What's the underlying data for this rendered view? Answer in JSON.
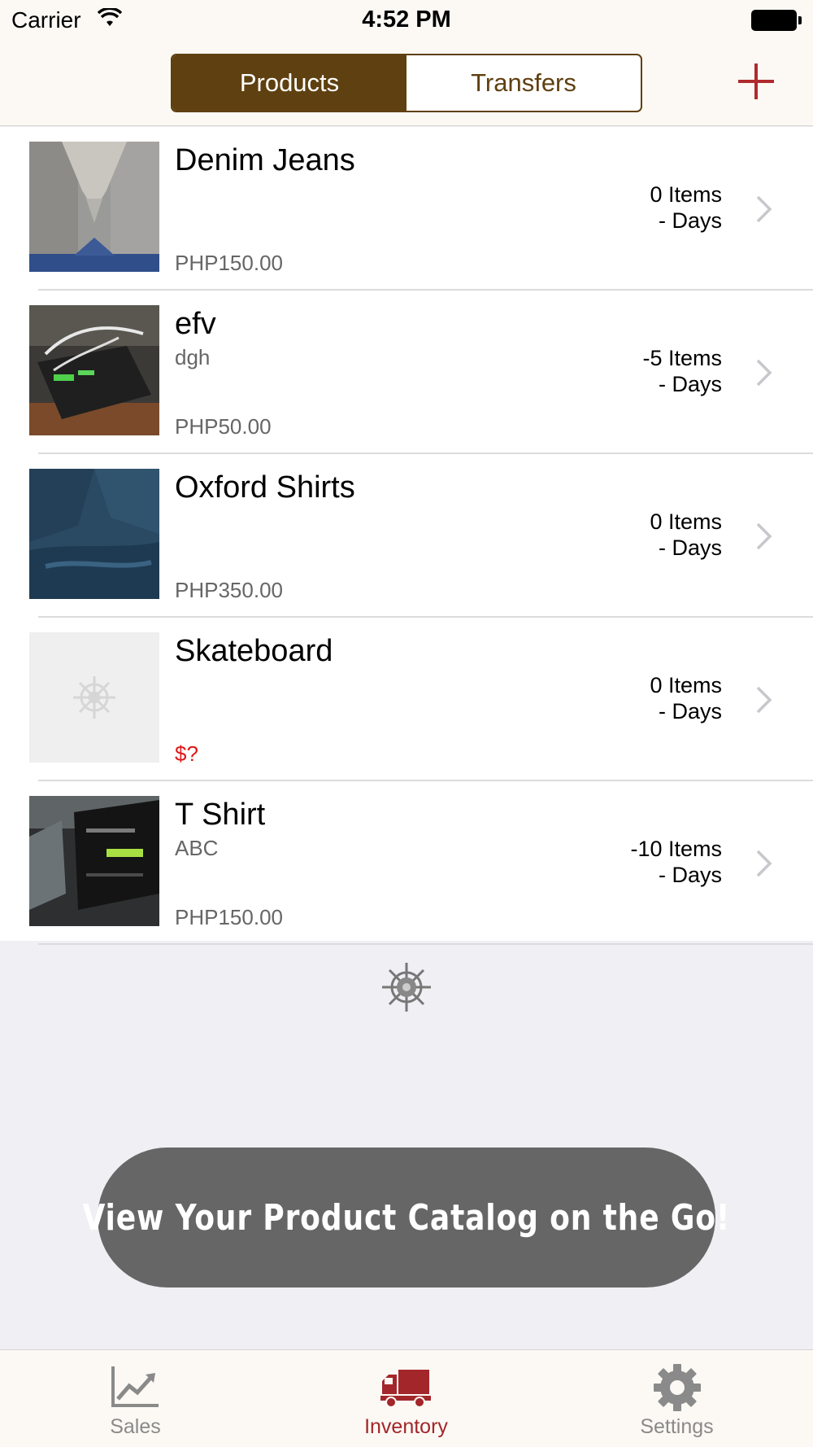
{
  "status_bar": {
    "carrier": "Carrier",
    "time": "4:52 PM"
  },
  "nav": {
    "segments": [
      "Products",
      "Transfers"
    ],
    "active_segment": "Products",
    "add_icon": "plus-icon",
    "accent_color": "#5f4010",
    "add_color": "#b02a2e"
  },
  "products": [
    {
      "name": "Denim Jeans",
      "description": "",
      "price": "PHP150.00",
      "items": "0 Items",
      "days": "- Days"
    },
    {
      "name": "efv",
      "description": "dgh",
      "price": "PHP50.00",
      "items": "-5 Items",
      "days": "- Days"
    },
    {
      "name": "Oxford Shirts",
      "description": "",
      "price": "PHP350.00",
      "items": "0 Items",
      "days": "- Days"
    },
    {
      "name": "Skateboard",
      "description": "",
      "price": "$?",
      "items": "0 Items",
      "days": "- Days"
    },
    {
      "name": "T Shirt",
      "description": "ABC",
      "price": "PHP150.00",
      "items": "-10 Items",
      "days": "- Days"
    }
  ],
  "promo": {
    "text": "View Your Product Catalog on the Go!"
  },
  "tabbar": {
    "tabs": [
      {
        "label": "Sales",
        "icon": "chart-icon"
      },
      {
        "label": "Inventory",
        "icon": "truck-icon"
      },
      {
        "label": "Settings",
        "icon": "gear-icon"
      }
    ],
    "active_tab": "Inventory",
    "active_color": "#a3262a"
  }
}
